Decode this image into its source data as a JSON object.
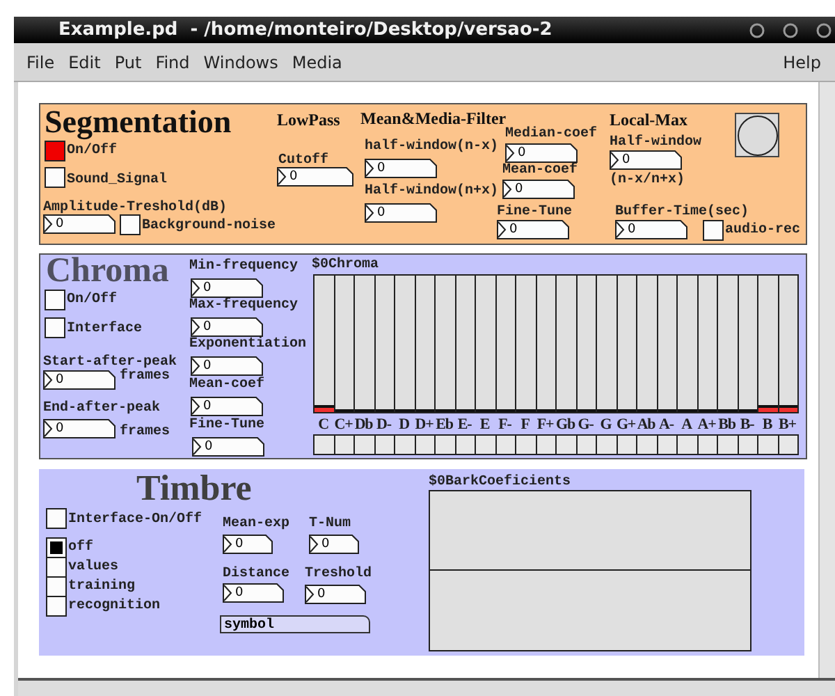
{
  "window": {
    "title": "Example.pd  - /home/monteiro/Desktop/versao-2"
  },
  "menu": {
    "items": [
      "File",
      "Edit",
      "Put",
      "Find",
      "Windows",
      "Media"
    ],
    "help": "Help"
  },
  "segmentation": {
    "items": [
      {
        "kind": "title",
        "text": "Segmentation"
      },
      {
        "kind": "toggle",
        "on": true
      },
      {
        "kind": "label",
        "text": "On/Off"
      },
      {
        "kind": "toggle",
        "on": false
      },
      {
        "kind": "label",
        "text": "Sound_Signal"
      },
      {
        "kind": "label",
        "text": "Amplitude-Treshold(dB)"
      },
      {
        "kind": "number",
        "value": "0"
      },
      {
        "kind": "toggle",
        "on": false
      },
      {
        "kind": "label",
        "text": "Background-noise"
      },
      {
        "kind": "heading",
        "text": "LowPass"
      },
      {
        "kind": "label",
        "text": "Cutoff"
      },
      {
        "kind": "number",
        "value": "0"
      },
      {
        "kind": "heading",
        "text": "Mean&Media-Filter"
      },
      {
        "kind": "label",
        "text": "half-window(n-x)"
      },
      {
        "kind": "number",
        "value": "0"
      },
      {
        "kind": "label",
        "text": "Half-window(n+x)"
      },
      {
        "kind": "number",
        "value": "0"
      },
      {
        "kind": "label",
        "text": "Median-coef"
      },
      {
        "kind": "number",
        "value": "0"
      },
      {
        "kind": "label",
        "text": "Mean-coef"
      },
      {
        "kind": "number",
        "value": "0"
      },
      {
        "kind": "label",
        "text": "Fine-Tune"
      },
      {
        "kind": "number",
        "value": "0"
      },
      {
        "kind": "heading",
        "text": "Local-Max"
      },
      {
        "kind": "label",
        "text": "Half-window"
      },
      {
        "kind": "number",
        "value": "0"
      },
      {
        "kind": "label",
        "text": "(n-x/n+x)"
      },
      {
        "kind": "label",
        "text": "Buffer-Time(sec)"
      },
      {
        "kind": "number",
        "value": "0"
      },
      {
        "kind": "toggle",
        "on": false
      },
      {
        "kind": "label",
        "text": "audio-rec"
      },
      {
        "kind": "bang"
      }
    ]
  },
  "chroma": {
    "items": [
      {
        "kind": "title",
        "text": "Chroma"
      },
      {
        "kind": "toggle",
        "on": false
      },
      {
        "kind": "label",
        "text": "On/Off"
      },
      {
        "kind": "toggle",
        "on": false
      },
      {
        "kind": "label",
        "text": "Interface"
      },
      {
        "kind": "label",
        "text": "Start-after-peak"
      },
      {
        "kind": "number",
        "value": "0"
      },
      {
        "kind": "label",
        "text": "frames"
      },
      {
        "kind": "label",
        "text": "End-after-peak"
      },
      {
        "kind": "number",
        "value": "0"
      },
      {
        "kind": "label",
        "text": "frames"
      },
      {
        "kind": "label",
        "text": "Min-frequency"
      },
      {
        "kind": "number",
        "value": "0"
      },
      {
        "kind": "label",
        "text": "Max-frequency"
      },
      {
        "kind": "number",
        "value": "0"
      },
      {
        "kind": "label",
        "text": "Exponentiation"
      },
      {
        "kind": "number",
        "value": "0"
      },
      {
        "kind": "label",
        "text": "Mean-coef"
      },
      {
        "kind": "number",
        "value": "0"
      },
      {
        "kind": "label",
        "text": "Fine-Tune"
      },
      {
        "kind": "number",
        "value": "0"
      }
    ],
    "chromagram": {
      "label": "$0Chroma",
      "bins": [
        {
          "note": "C",
          "level": 0.03,
          "checked": false
        },
        {
          "note": "C+",
          "level": 0,
          "checked": false
        },
        {
          "note": "Db",
          "level": 0,
          "checked": false
        },
        {
          "note": "D-",
          "level": 0,
          "checked": false
        },
        {
          "note": "D",
          "level": 0,
          "checked": false
        },
        {
          "note": "D+",
          "level": 0,
          "checked": false
        },
        {
          "note": "Eb",
          "level": 0,
          "checked": false
        },
        {
          "note": "E-",
          "level": 0,
          "checked": false
        },
        {
          "note": "E",
          "level": 0,
          "checked": false
        },
        {
          "note": "F-",
          "level": 0,
          "checked": false
        },
        {
          "note": "F",
          "level": 0,
          "checked": false
        },
        {
          "note": "F+",
          "level": 0,
          "checked": false
        },
        {
          "note": "Gb",
          "level": 0,
          "checked": false
        },
        {
          "note": "G-",
          "level": 0,
          "checked": false
        },
        {
          "note": "G",
          "level": 0,
          "checked": false
        },
        {
          "note": "G+",
          "level": 0,
          "checked": false
        },
        {
          "note": "Ab",
          "level": 0,
          "checked": false
        },
        {
          "note": "A-",
          "level": 0,
          "checked": false
        },
        {
          "note": "A",
          "level": 0,
          "checked": false
        },
        {
          "note": "A+",
          "level": 0,
          "checked": false
        },
        {
          "note": "Bb",
          "level": 0,
          "checked": false
        },
        {
          "note": "B-",
          "level": 0,
          "checked": false
        },
        {
          "note": "B",
          "level": 0.03,
          "checked": false
        },
        {
          "note": "B+",
          "level": 0.03,
          "checked": false
        }
      ]
    }
  },
  "timbre": {
    "items": [
      {
        "kind": "title",
        "text": "Timbre"
      },
      {
        "kind": "toggle",
        "on": false
      },
      {
        "kind": "label",
        "text": "Interface-On/Off"
      },
      {
        "kind": "radio",
        "options": [
          {
            "label": "off",
            "selected": true
          },
          {
            "label": "values",
            "selected": false
          },
          {
            "label": "training",
            "selected": false
          },
          {
            "label": "recognition",
            "selected": false
          }
        ]
      },
      {
        "kind": "label",
        "text": "Mean-exp"
      },
      {
        "kind": "number",
        "value": "0"
      },
      {
        "kind": "label",
        "text": "T-Num"
      },
      {
        "kind": "number",
        "value": "0"
      },
      {
        "kind": "label",
        "text": "Distance"
      },
      {
        "kind": "number",
        "value": "0"
      },
      {
        "kind": "label",
        "text": "Treshold"
      },
      {
        "kind": "number",
        "value": "0"
      },
      {
        "kind": "symbol",
        "value": "symbol"
      }
    ],
    "array": {
      "label": "$0BarkCoeficients"
    }
  }
}
